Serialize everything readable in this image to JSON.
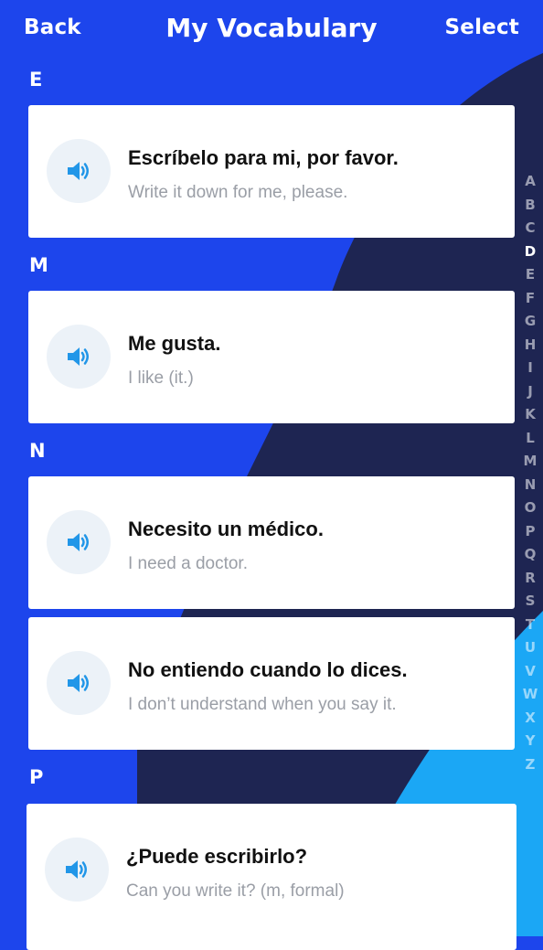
{
  "header": {
    "back_label": "Back",
    "title": "My Vocabulary",
    "select_label": "Select"
  },
  "sections": [
    {
      "letter": "E",
      "items": [
        {
          "phrase": "Escríbelo para mi, por favor.",
          "translation": "Write it down for me, please."
        }
      ]
    },
    {
      "letter": "M",
      "items": [
        {
          "phrase": "Me gusta.",
          "translation": "I like (it.)"
        }
      ]
    },
    {
      "letter": "N",
      "items": [
        {
          "phrase": "Necesito un médico.",
          "translation": "I need a doctor."
        },
        {
          "phrase": "No entiendo cuando lo dices.",
          "translation": "I don’t understand when you say it."
        }
      ]
    },
    {
      "letter": "P",
      "items": [
        {
          "phrase": "¿Puede escribirlo?",
          "translation": "Can you write it? (m, formal)"
        }
      ]
    }
  ],
  "alphabet_index": {
    "letters": [
      "A",
      "B",
      "C",
      "D",
      "E",
      "F",
      "G",
      "H",
      "I",
      "J",
      "K",
      "L",
      "M",
      "N",
      "O",
      "P",
      "Q",
      "R",
      "S",
      "T",
      "U",
      "V",
      "W",
      "X",
      "Y",
      "Z"
    ],
    "active": "D"
  },
  "icons": {
    "speaker": "speaker-volume-icon"
  },
  "colors": {
    "primary_blue": "#1d45ec",
    "navy": "#1e2552",
    "light_blue": "#1ba7f5",
    "speaker_blue": "#2196e8",
    "card_bg": "#ffffff",
    "translation_gray": "#9a9ea6"
  }
}
